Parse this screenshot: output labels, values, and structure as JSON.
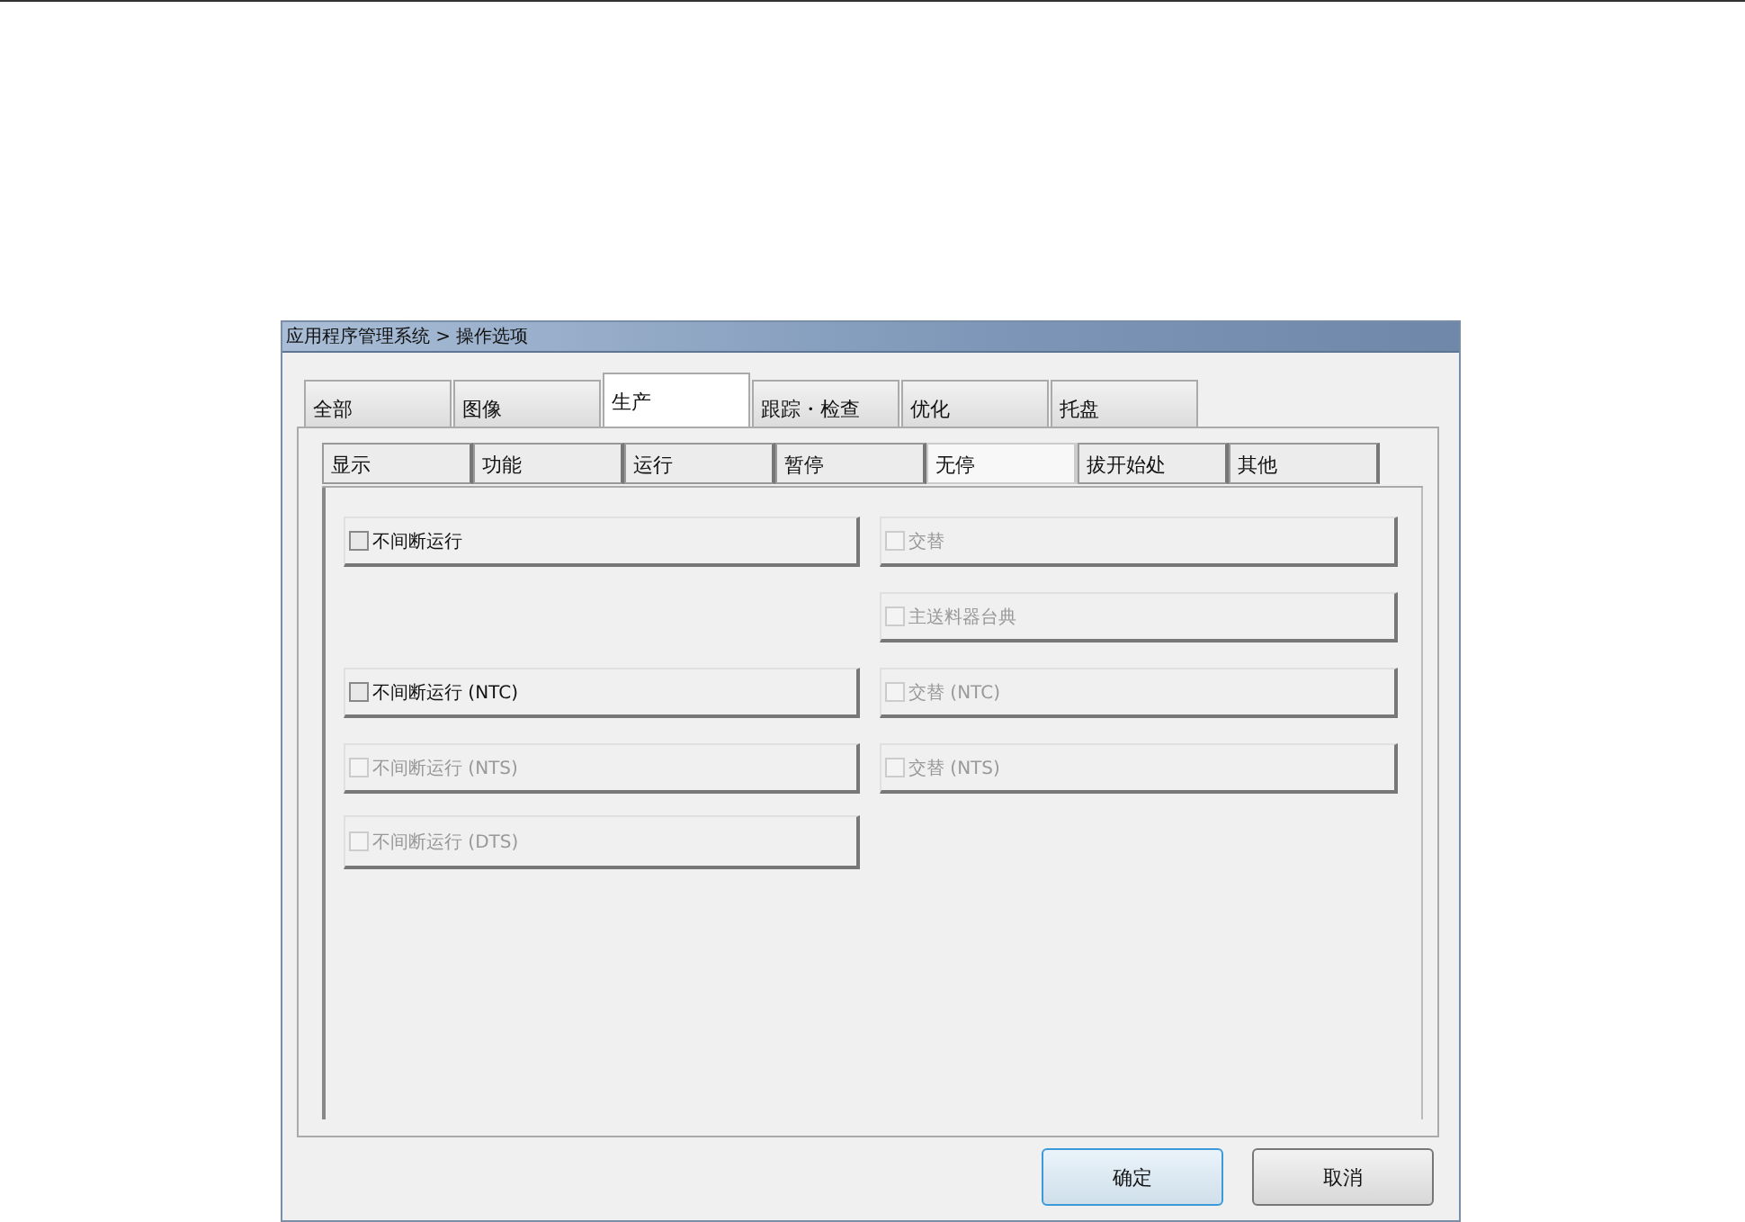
{
  "window": {
    "title": "应用程序管理系统 > 操作选项"
  },
  "tabs": [
    {
      "label": "全部",
      "selected": false
    },
    {
      "label": "图像",
      "selected": false
    },
    {
      "label": "生产",
      "selected": true
    },
    {
      "label": "跟踪・检查",
      "selected": false
    },
    {
      "label": "优化",
      "selected": false
    },
    {
      "label": "托盘",
      "selected": false
    }
  ],
  "subtabs": [
    {
      "label": "显示",
      "selected": false
    },
    {
      "label": "功能",
      "selected": false
    },
    {
      "label": "运行",
      "selected": false
    },
    {
      "label": "暂停",
      "selected": false
    },
    {
      "label": "无停",
      "selected": true
    },
    {
      "label": "拔开始处",
      "selected": false
    },
    {
      "label": "其他",
      "selected": false
    }
  ],
  "option_rows": [
    {
      "left": {
        "label": "不间断运行",
        "checked": false,
        "disabled": false
      },
      "right": {
        "label": "交替",
        "checked": false,
        "disabled": true
      }
    },
    {
      "right": {
        "label": "主送料器台典",
        "checked": false,
        "disabled": true
      }
    },
    {
      "left": {
        "label": "不间断运行 (NTC)",
        "checked": false,
        "disabled": false
      },
      "right": {
        "label": "交替 (NTC)",
        "checked": false,
        "disabled": true
      }
    },
    {
      "left": {
        "label": "不间断运行 (NTS)",
        "checked": false,
        "disabled": true
      },
      "right": {
        "label": "交替 (NTS)",
        "checked": false,
        "disabled": true
      }
    },
    {
      "left": {
        "label": "不间断运行 (DTS)",
        "checked": false,
        "disabled": true
      }
    }
  ],
  "buttons": [
    {
      "label": "确定",
      "kind": "default"
    },
    {
      "label": "取消",
      "kind": "normal"
    }
  ]
}
